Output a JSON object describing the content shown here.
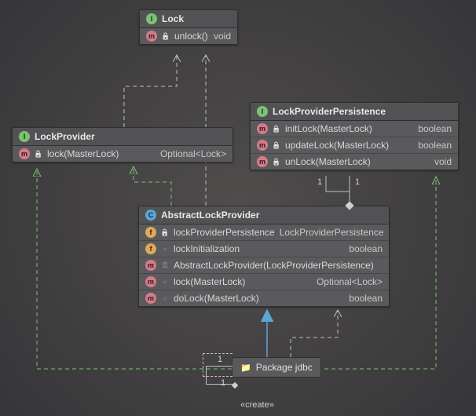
{
  "lock": {
    "title": "Lock",
    "members": [
      {
        "badge": "m",
        "vis": "lock",
        "sig": "unlock()",
        "ret": "void"
      }
    ]
  },
  "lockProvider": {
    "title": "LockProvider",
    "members": [
      {
        "badge": "m",
        "vis": "lock",
        "sig": "lock(MasterLock)",
        "ret": "Optional<Lock>"
      }
    ]
  },
  "lockProviderPersistence": {
    "title": "LockProviderPersistence",
    "members": [
      {
        "badge": "m",
        "vis": "lock",
        "sig": "initLock(MasterLock)",
        "ret": "boolean"
      },
      {
        "badge": "m",
        "vis": "lock",
        "sig": "updateLock(MasterLock)",
        "ret": "boolean"
      },
      {
        "badge": "m",
        "vis": "lock",
        "sig": "unLock(MasterLock)",
        "ret": "void"
      }
    ]
  },
  "abstractLockProvider": {
    "title": "AbstractLockProvider",
    "members": [
      {
        "badge": "f",
        "vis": "lock",
        "sig": "lockProviderPersistence",
        "ret": "LockProviderPersistence"
      },
      {
        "badge": "f",
        "vis": "open",
        "sig": "lockInitialization",
        "ret": "boolean"
      },
      {
        "badge": "m",
        "vis": "key",
        "sig": "AbstractLockProvider(LockProviderPersistence)",
        "ret": ""
      },
      {
        "badge": "m",
        "vis": "open",
        "sig": "lock(MasterLock)",
        "ret": "Optional<Lock>"
      },
      {
        "badge": "m",
        "vis": "open",
        "sig": "doLock(MasterLock)",
        "ret": "boolean"
      }
    ]
  },
  "package": {
    "label": "Package jdbc"
  },
  "stereotypes": {
    "create": "«create»"
  },
  "multiplicities": {
    "one_a": "1",
    "one_b": "1",
    "one_c": "1"
  }
}
